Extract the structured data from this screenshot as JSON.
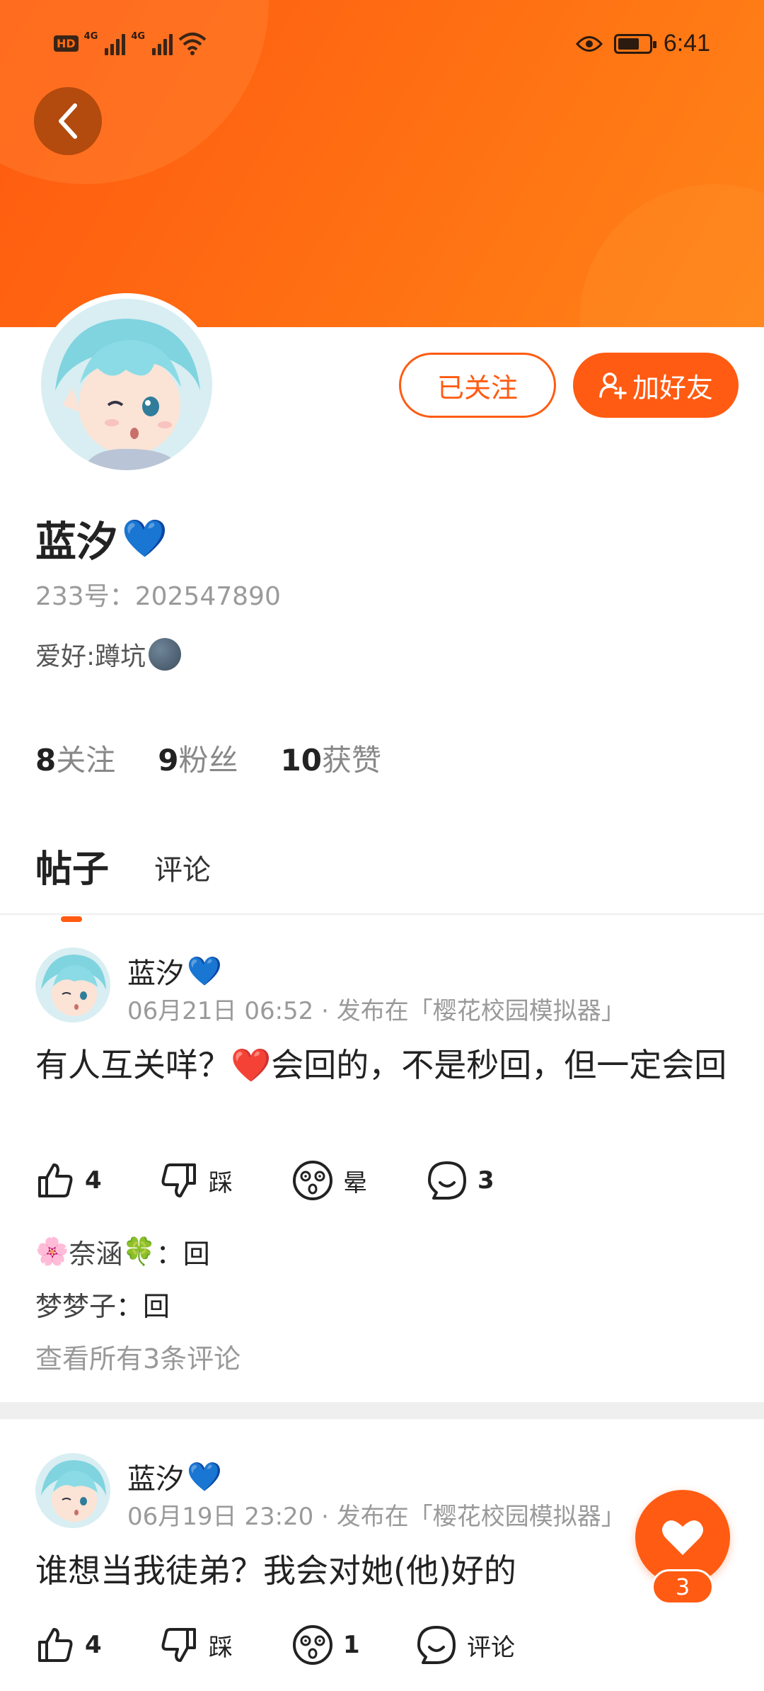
{
  "status_bar": {
    "network_label": "HD",
    "sim1": "4G",
    "sim2": "4G",
    "time": "6:41",
    "battery_percent": 70
  },
  "profile": {
    "name": "蓝汐",
    "name_emoji": "💙",
    "id_label": "233号：202547890",
    "bio": "爱好:蹲坑",
    "followed_label": "已关注",
    "add_friend_label": "加好友",
    "stats": [
      {
        "value": "8",
        "label": "关注"
      },
      {
        "value": "9",
        "label": "粉丝"
      },
      {
        "value": "10",
        "label": "获赞"
      }
    ]
  },
  "tabs": {
    "posts": "帖子",
    "comments": "评论"
  },
  "posts": [
    {
      "author": "蓝汐",
      "author_emoji": "💙",
      "meta": "06月21日 06:52 · 发布在「樱花校园模拟器」",
      "text_a": "有人互关咩？",
      "text_emoji": "❤️",
      "text_b": "会回的，不是秒回，但一定会回",
      "likes": "4",
      "dislike_label": "踩",
      "dizzy_label": "晕",
      "comments_count": "3",
      "comments": [
        {
          "emoji_pre": "🌸",
          "name": "奈涵",
          "emoji_post": "🍀",
          "sep": "：",
          "text": "回"
        },
        {
          "name": "梦梦子",
          "sep": "：",
          "text": "回"
        }
      ],
      "view_all": "查看所有3条评论"
    },
    {
      "author": "蓝汐",
      "author_emoji": "💙",
      "meta": "06月19日 23:20 · 发布在「樱花校园模拟器」",
      "text": "谁想当我徒弟？我会对她(他)好的",
      "likes": "4",
      "dislike_label": "踩",
      "dizzy_count": "1",
      "comment_label": "评论"
    }
  ],
  "fab": {
    "count": "3"
  },
  "colors": {
    "accent": "#ff5b12",
    "header_start": "#ff5a10",
    "header_end": "#ff8418"
  }
}
